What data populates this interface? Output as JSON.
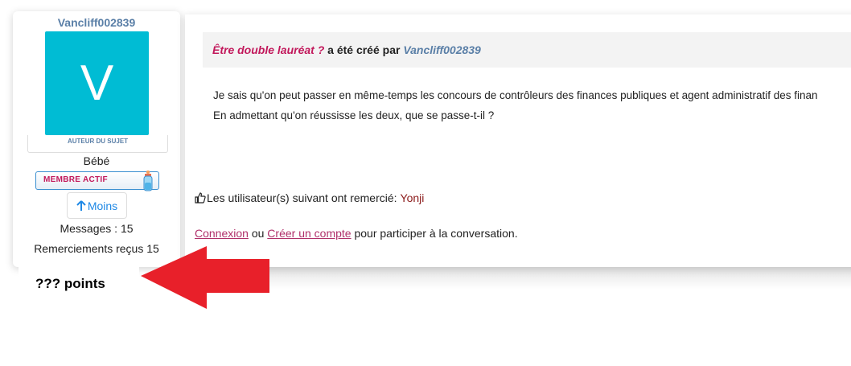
{
  "user_panel": {
    "username": "Vancliff002839",
    "avatar_letter": "V",
    "author_tag": "AUTEUR DU SUJET",
    "rank": "Bébé",
    "badge": "MEMBRE ACTIF",
    "toggle_label": "Moins",
    "messages": "Messages : 15",
    "thanks_received": "Remerciements reçus 15",
    "points": "??? points"
  },
  "topic": {
    "title": "Être double lauréat ?",
    "created_text": "a été créé par",
    "author": "Vancliff002839"
  },
  "post": {
    "line1": "Je sais qu'on peut passer en même-temps les concours de contrôleurs des finances publiques et agent administratif des finan",
    "line2": "En admettant qu'on réussisse les deux, que se passe-t-il ?"
  },
  "thanks": {
    "label": "Les utilisateur(s) suivant ont remercié:",
    "user": "Yonji"
  },
  "login": {
    "connexion": "Connexion",
    "ou": "ou",
    "create_account": "Créer un compte",
    "suffix": "pour participer à la conversation."
  },
  "colors": {
    "avatar_bg": "#00bcd4",
    "annotation_arrow": "#e8202a",
    "topic_title": "#c2185b",
    "username": "#5a7fa7"
  }
}
